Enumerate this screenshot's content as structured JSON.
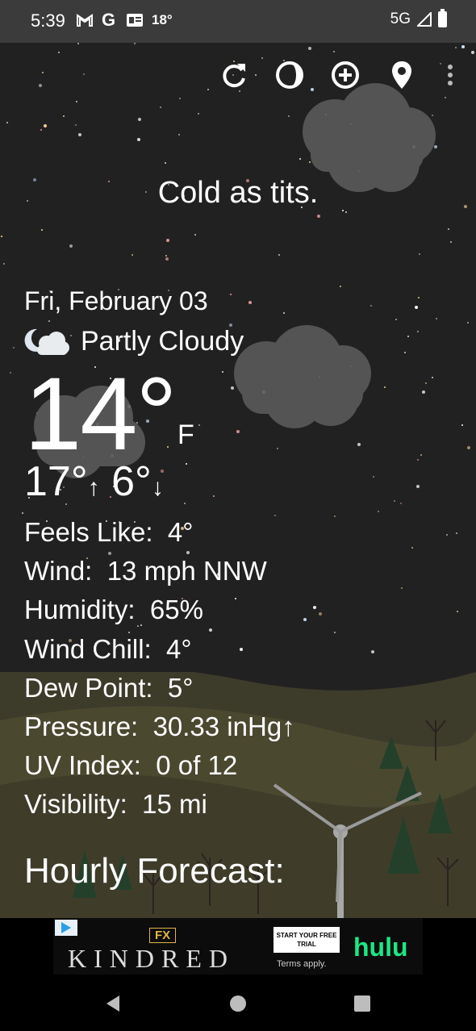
{
  "status_bar": {
    "time": "5:39",
    "temp": "18°",
    "network": "5G",
    "icons": [
      "gmail-icon",
      "google-icon",
      "news-icon",
      "signal-icon",
      "battery-icon"
    ]
  },
  "toolbar": {
    "icons": [
      "refresh-icon",
      "moon-phase-icon",
      "add-icon",
      "location-icon",
      "more-icon"
    ]
  },
  "tagline": "Cold as tits.",
  "weather": {
    "date": "Fri, February 03",
    "condition": "Partly Cloudy",
    "condition_icon": "partly-cloudy-night-icon",
    "temperature": "14°",
    "unit": "F",
    "high": "17°",
    "low": "6°",
    "high_arrow": "↑",
    "low_arrow": "↓"
  },
  "details": [
    {
      "label": "Feels Like:",
      "value": "4°"
    },
    {
      "label": "Wind:",
      "value": "13 mph NNW"
    },
    {
      "label": "Humidity:",
      "value": "65%"
    },
    {
      "label": "Wind Chill:",
      "value": "4°"
    },
    {
      "label": "Dew Point:",
      "value": "5°"
    },
    {
      "label": "Pressure:",
      "value": "30.33 inHg↑"
    },
    {
      "label": "UV Index:",
      "value": "0 of 12"
    },
    {
      "label": "Visibility:",
      "value": "15 mi"
    }
  ],
  "hourly_heading": "Hourly Forecast:",
  "ad": {
    "network": "FX",
    "title": "KINDRED",
    "cta": "START YOUR FREE TRIAL",
    "terms": "Terms apply.",
    "brand": "hulu"
  },
  "nav": [
    "back-icon",
    "home-icon",
    "recents-icon"
  ],
  "colors": {
    "background": "#212121",
    "statusbar": "#3b3b3b",
    "hulu": "#1ce783"
  }
}
